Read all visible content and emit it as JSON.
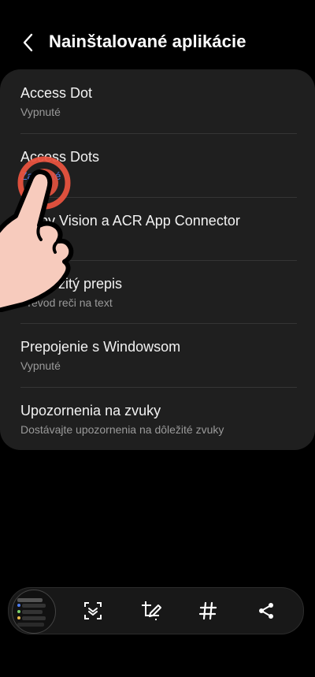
{
  "header": {
    "title": "Nainštalované aplikácie",
    "back_icon": "chevron-left-icon"
  },
  "apps": [
    {
      "name": "Access Dot",
      "status": "Vypnuté"
    },
    {
      "name": "Access Dots",
      "status": "Zapnuté"
    },
    {
      "name": "Bixby Vision a ACR App Connector",
      "status": "Vypnuté"
    },
    {
      "name": "Okamžitý prepis",
      "status": "Prevod reči na text"
    },
    {
      "name": "Prepojenie s Windowsom",
      "status": "Vypnuté"
    },
    {
      "name": "Upozornenia na zvuky",
      "status": "Dostávajte upozornenia na dôležité zvuky"
    }
  ],
  "toolbar": {
    "icons": [
      "screenshot-thumbnail",
      "scroll-capture-icon",
      "crop-edit-icon",
      "hashtag-icon",
      "share-icon"
    ]
  },
  "colors": {
    "background": "#000000",
    "card": "#1f1f1f",
    "accent_blue": "#4d7cf0",
    "touch_indicator": "#e8533f"
  }
}
